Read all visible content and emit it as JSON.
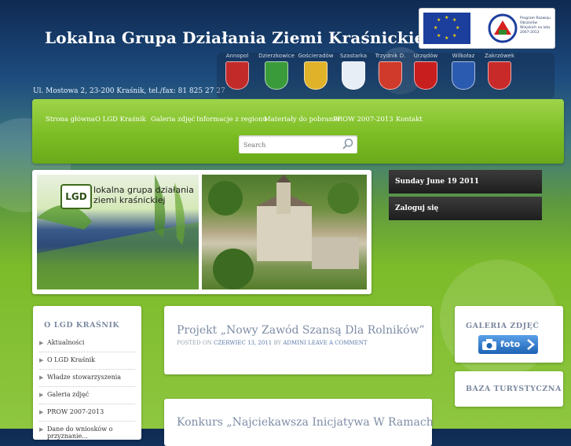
{
  "header": {
    "title": "Lokalna Grupa Działania Ziemi Kraśnickiej",
    "address": "Ul. Mostowa 2, 23-200 Kraśnik, tel./fax: 81 825 27 27",
    "eu_logo_text": "Program Rozwoju Obszarów Wiejskich na lata 2007-2013",
    "crests": [
      "Annopol",
      "Dzierzkowice",
      "Gościeradów",
      "Szastarka",
      "Trzydnik D.",
      "Urzędów",
      "Wilkołaz",
      "Zakrzówek"
    ]
  },
  "nav": {
    "items": [
      "Strona główna",
      "O LGD Kraśnik",
      "Galeria zdjęć",
      "Informacje z regionu",
      "Materiały do pobrania",
      "PROW 2007-2013",
      "Kontakt"
    ]
  },
  "search": {
    "placeholder": "Search"
  },
  "banner": {
    "logo": "LGD",
    "text_line1": "lokalna grupa działania",
    "text_line2": "ziemi kraśnickiej"
  },
  "side_top": {
    "date": "Sunday June 19 2011",
    "login": "Zaloguj się"
  },
  "left_menu": {
    "title": "O LGD KRAŚNIK",
    "items": [
      "Aktualności",
      "O LGD Kraśnik",
      "Władze stowarzyszenia",
      "Galeria zdjęć",
      "PROW 2007-2013",
      "Dane do wniosków o przyznanie..."
    ]
  },
  "posts": [
    {
      "title": "Projekt „Nowy Zawód Szansą Dla Rolników”",
      "meta_prefix": "POSTED ON",
      "date": "CZERWIEC 13, 2011",
      "meta_by": "BY",
      "author": "ADMINI",
      "comment": "LEAVE A COMMENT"
    },
    {
      "title": "Konkurs „Najciekawsza Inicjatywa W Ramach"
    }
  ],
  "right_widgets": {
    "gallery_title": "GALERIA ZDJĘĆ",
    "foto_label": "foto",
    "tourism_title": "BAZA TURYSTYCZNA"
  },
  "colors": {
    "nav_green": "#7cbd24",
    "title_blue": "#7e8da6",
    "sky_dark": "#0f2a52"
  }
}
